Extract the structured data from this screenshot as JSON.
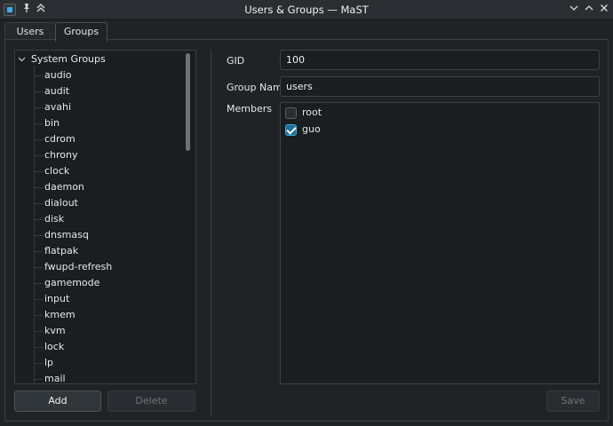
{
  "window": {
    "title": "Users & Groups — MaST",
    "icons": [
      "app-icon",
      "pin-icon",
      "keep-above-icon",
      "minimize-icon",
      "maximize-icon",
      "close-icon"
    ]
  },
  "tabs": [
    {
      "label": "Users",
      "active": false
    },
    {
      "label": "Groups",
      "active": true
    }
  ],
  "tree": {
    "root_label": "System Groups",
    "expanded": true,
    "items": [
      "audio",
      "audit",
      "avahi",
      "bin",
      "cdrom",
      "chrony",
      "clock",
      "daemon",
      "dialout",
      "disk",
      "dnsmasq",
      "flatpak",
      "fwupd-refresh",
      "gamemode",
      "input",
      "kmem",
      "kvm",
      "lock",
      "lp",
      "mail"
    ]
  },
  "buttons": {
    "add": "Add",
    "delete": "Delete",
    "save": "Save"
  },
  "form": {
    "gid_label": "GID",
    "gid_value": "100",
    "group_name_label": "Group Name",
    "group_name_value": "users",
    "members_label": "Members",
    "members": [
      {
        "name": "root",
        "checked": false
      },
      {
        "name": "guo",
        "checked": true
      }
    ]
  },
  "colors": {
    "background": "#202326",
    "accent": "#3daee9"
  }
}
